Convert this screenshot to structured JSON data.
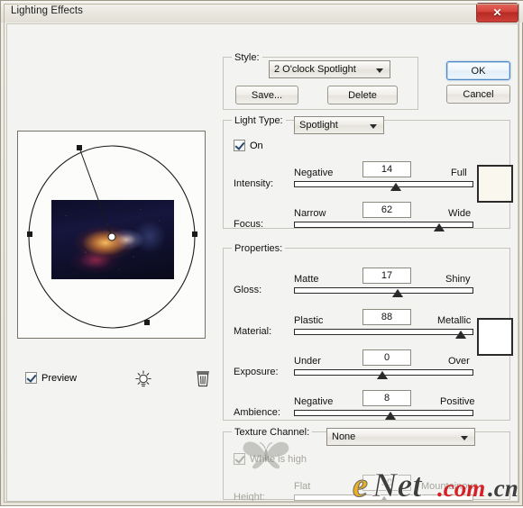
{
  "window": {
    "title": "Lighting Effects",
    "close_label": "✕"
  },
  "preview": {
    "checkbox_label": "Preview",
    "bulb_icon": "light-bulb-icon",
    "trash_icon": "trash-icon",
    "image_alt": "dark tunnel night scene with warm lights"
  },
  "style_group": {
    "label": "Style:",
    "selected": "2 O'clock Spotlight",
    "save_label": "Save...",
    "delete_label": "Delete"
  },
  "action_buttons": {
    "ok_label": "OK",
    "cancel_label": "Cancel"
  },
  "light_type_group": {
    "label": "Light Type:",
    "selected": "Spotlight",
    "on_label": "On",
    "on_checked": true,
    "intensity": {
      "label": "Intensity:",
      "min_label": "Negative",
      "max_label": "Full",
      "value": "14",
      "percent": 57
    },
    "focus": {
      "label": "Focus:",
      "min_label": "Narrow",
      "max_label": "Wide",
      "value": "62",
      "percent": 81
    },
    "color_swatch": "#faf7ef"
  },
  "properties_group": {
    "label": "Properties:",
    "gloss": {
      "label": "Gloss:",
      "min_label": "Matte",
      "max_label": "Shiny",
      "value": "17",
      "percent": 58
    },
    "material": {
      "label": "Material:",
      "min_label": "Plastic",
      "max_label": "Metallic",
      "value": "88",
      "percent": 93
    },
    "exposure": {
      "label": "Exposure:",
      "min_label": "Under",
      "max_label": "Over",
      "value": "0",
      "percent": 49
    },
    "ambience": {
      "label": "Ambience:",
      "min_label": "Negative",
      "max_label": "Positive",
      "value": "8",
      "percent": 54
    },
    "color_swatch": "#ffffff"
  },
  "texture_group": {
    "label": "Texture Channel:",
    "selected": "None",
    "white_is_high_label": "White is high",
    "white_is_high_checked": true,
    "height": {
      "label": "Height:",
      "min_label": "Flat",
      "max_label": "Mountainous",
      "value": "50",
      "percent": 50
    }
  },
  "watermark": {
    "text_e": "e",
    "text_net": "Net",
    "text_com": ".com",
    "text_cn": ".cn",
    "color_e": "#edb11e",
    "color_net": "#3f3f3f",
    "color_com": "#d42026",
    "color_cn": "#3f3f3f"
  }
}
